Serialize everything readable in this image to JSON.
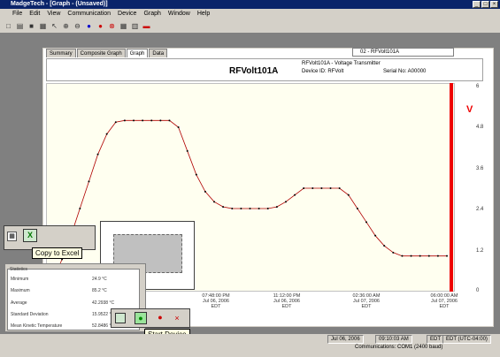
{
  "titlebar": {
    "title": "MadgeTech - [Graph - (Unsaved)]"
  },
  "menu": [
    "File",
    "Edit",
    "View",
    "Communication",
    "Device",
    "Graph",
    "Window",
    "Help"
  ],
  "tabs": [
    "Summary",
    "Composite Graph",
    "Graph",
    "Data"
  ],
  "active_tab": "Graph",
  "channel_select": "02 - RFVolt101A",
  "header": {
    "device_title": "RFVolt101A",
    "line1": "RFVolt101A - Voltage Transmitter",
    "device_id": "Device ID: RFVolt",
    "serial": "Serial No: A00000"
  },
  "unit_label": "V",
  "colors": {
    "series": "#b00000",
    "redbar": "#e00000",
    "accent": "#0a246a"
  },
  "chart_data": {
    "type": "line",
    "y_ticks": [
      "6",
      "4.8",
      "3.6",
      "2.4",
      "1.2",
      "0"
    ],
    "ylim": [
      0,
      6
    ],
    "x_ticks": [
      {
        "time": "07:48:00 PM",
        "date": "Jul 06, 2006",
        "tz": "EDT"
      },
      {
        "time": "11:12:00 PM",
        "date": "Jul 06, 2006",
        "tz": "EDT"
      },
      {
        "time": "02:36:00 AM",
        "date": "Jul 07, 2006",
        "tz": "EDT"
      },
      {
        "time": "06:00:00 AM",
        "date": "Jul 07, 2006",
        "tz": "EDT"
      }
    ],
    "series": [
      {
        "x": [
          0,
          0.5,
          1,
          1.5,
          2,
          2.5,
          3,
          3.5,
          4,
          4.5,
          5,
          5.5,
          6,
          6.5,
          7,
          7.5,
          8,
          8.5,
          9,
          9.5,
          10,
          10.5,
          11,
          11.5,
          12,
          12.5,
          13,
          13.5,
          14,
          14.5,
          15,
          15.5,
          16,
          16.5,
          17,
          17.5,
          18,
          18.5,
          19,
          19.5,
          20,
          20.5,
          21,
          21.5,
          22
        ],
        "values": [
          0.3,
          0.9,
          1.6,
          2.4,
          3.2,
          4.0,
          4.6,
          4.95,
          5.0,
          5.0,
          5.0,
          5.0,
          5.0,
          5.0,
          4.8,
          4.1,
          3.4,
          2.9,
          2.6,
          2.45,
          2.4,
          2.4,
          2.4,
          2.4,
          2.4,
          2.45,
          2.6,
          2.8,
          3.0,
          3.0,
          3.0,
          3.0,
          3.0,
          2.8,
          2.4,
          2.0,
          1.6,
          1.3,
          1.1,
          1.0,
          1.0,
          1.0,
          1.0,
          1.0,
          1.0
        ]
      }
    ]
  },
  "tooltip_excel": "Copy to Excel",
  "tooltip_start": "Start Device",
  "stats": {
    "title": "Statistics",
    "rows": [
      {
        "label": "Minimum",
        "value": "24.9 °C"
      },
      {
        "label": "Maximum",
        "value": "85.2 °C"
      },
      {
        "label": "Average",
        "value": "42.2938 °C"
      },
      {
        "label": "Standard Deviation",
        "value": "15.9522 °C"
      },
      {
        "label": "Mean Kinetic Temperature",
        "value": "52.8486 °C"
      }
    ]
  },
  "status": {
    "date": "Jul 06, 2006",
    "time": "09:10:03 AM",
    "tz": "EDT",
    "utc": "EDT (UTC-04:00)",
    "comm": "Communications: COM1 (2400 baud)"
  }
}
